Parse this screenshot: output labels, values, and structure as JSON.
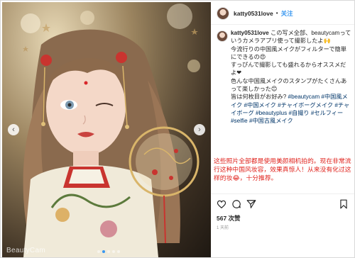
{
  "post": {
    "username": "katty0531love",
    "separator": "•",
    "follow_label": "关注",
    "watermark": "BeautyCam",
    "caption": {
      "username": "katty0531love",
      "line1": "この写メ全部、beautycamっていうカメラアプリ使って撮影したよ🙌",
      "line2": "今流行りの中国風メイクがフィルターで簡単にできるの😍",
      "line3": "すっぴんで撮影しても盛れるからオススメだよ❤",
      "line4": "色んな中国風メイクのスタンプがたくさんあって楽しかった😊",
      "line5": "皆は何枚目がお好み?",
      "hashtags": "#beautycam #中国風メイク #中国メイク #チャイボーグメイク #チャイボーグ #beautyplus #自撮り #セルフィー #selfie #中国古風メイク"
    },
    "overlay_text": "这些照片全部都是使用美颜相机拍的。现在非常流行这种中国风妆容，效果真惊人！从来没有化过这样的妆😂，十分推荐。",
    "likes": "567 次赞",
    "date": "1 天前",
    "icons": {
      "like": "heart-icon",
      "comment": "comment-icon",
      "share": "share-icon",
      "save": "bookmark-icon"
    },
    "colors": {
      "link": "#3897f0",
      "overlay": "#e0241e"
    }
  }
}
